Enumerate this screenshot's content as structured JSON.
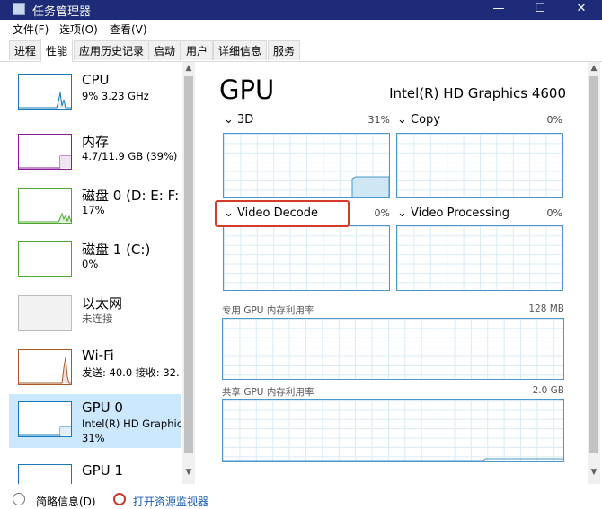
{
  "window": {
    "title": "任务管理器",
    "minimize": "—",
    "maximize": "☐",
    "close": "✕"
  },
  "menu": [
    "文件(F)",
    "选项(O)",
    "查看(V)"
  ],
  "tabs": [
    "进程",
    "性能",
    "应用历史记录",
    "启动",
    "用户",
    "详细信息",
    "服务"
  ],
  "sidebar": [
    {
      "name": "CPU",
      "line1": "9% 3.23 GHz",
      "line2": "",
      "color": "#1779ba"
    },
    {
      "name": "内存",
      "line1": "4.7/11.9 GB (39%)",
      "line2": "",
      "color": "#8b1a99"
    },
    {
      "name": "磁盘 0 (D: E: F:",
      "line1": "17%",
      "line2": "",
      "color": "#4ea72e"
    },
    {
      "name": "磁盘 1 (C:)",
      "line1": "0%",
      "line2": "",
      "color": "#4ea72e"
    },
    {
      "name": "以太网",
      "line1": "未连接",
      "line2": "",
      "color": "#bbbbbb"
    },
    {
      "name": "Wi-Fi",
      "line1": "发送: 40.0  接收: 32.",
      "line2": "",
      "color": "#a7592d"
    },
    {
      "name": "GPU 0",
      "line1": "Intel(R) HD Graphic",
      "line2": "31%",
      "color": "#1779ba"
    },
    {
      "name": "GPU 1",
      "line1": "",
      "line2": "",
      "color": "#1779ba"
    }
  ],
  "gpu": {
    "title": "GPU",
    "model": "Intel(R) HD Graphics 4600",
    "engines": [
      {
        "label": "3D",
        "pct": "31%"
      },
      {
        "label": "Copy",
        "pct": "0%"
      },
      {
        "label": "Video Decode",
        "pct": "0%"
      },
      {
        "label": "Video Processing",
        "pct": "0%"
      }
    ],
    "dedicated": {
      "label": "专用 GPU 内存利用率",
      "value": "128 MB"
    },
    "shared": {
      "label": "共享 GPU 内存利用率",
      "value": "2.0 GB"
    }
  },
  "footer": {
    "summary": "简略信息(D)",
    "monitor": "打开资源监视器"
  }
}
